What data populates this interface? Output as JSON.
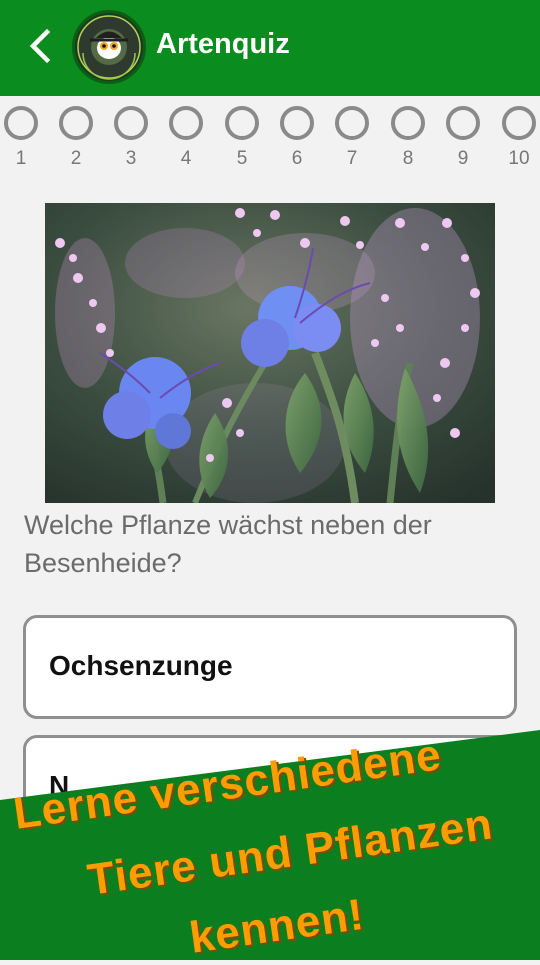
{
  "header": {
    "title": "Artenquiz",
    "logo_text": "REGIO-RANGER – FÜR MENSCH UND NATUR"
  },
  "progress": {
    "steps": [
      "1",
      "2",
      "3",
      "4",
      "5",
      "6",
      "7",
      "8",
      "9",
      "10"
    ]
  },
  "question": {
    "text": "Welche Pflanze wächst neben der Besenheide?"
  },
  "answers": [
    {
      "label": "Ochsenzunge"
    },
    {
      "label": "N"
    }
  ],
  "promo": {
    "lines": [
      "Lerne verschiedene",
      "Tiere und Pflanzen",
      "kennen!"
    ]
  },
  "colors": {
    "header_green": "#0a8c1e",
    "promo_green": "#0b7f20",
    "promo_text": "#ff9c00"
  }
}
